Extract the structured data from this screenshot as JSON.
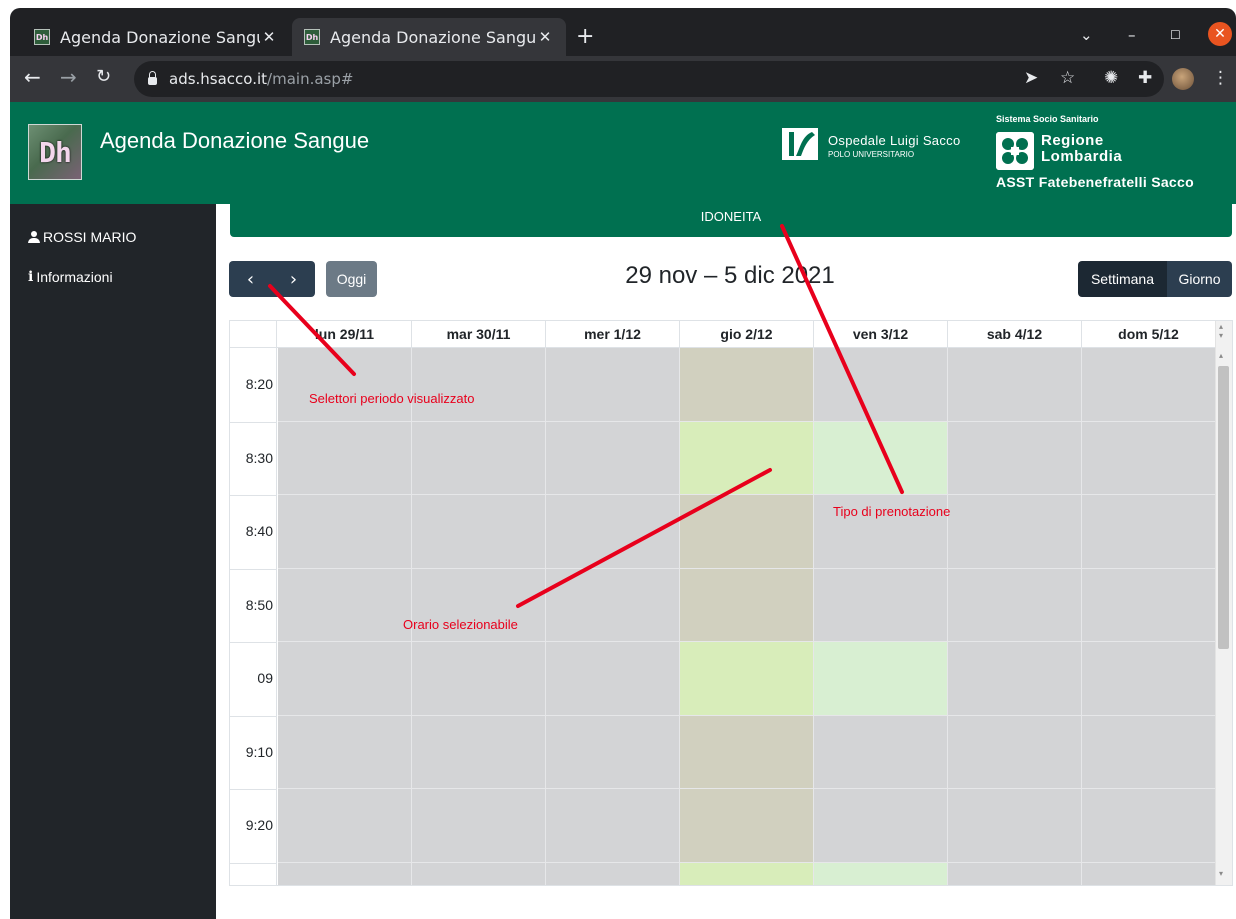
{
  "browser": {
    "tabs": [
      {
        "title": "Agenda Donazione Sangue",
        "favicon": "Dh",
        "active": false
      },
      {
        "title": "Agenda Donazione Sangue",
        "favicon": "Dh",
        "active": true
      }
    ],
    "new_tab_symbol": "+",
    "url_host": "ads.hsacco.it",
    "url_path": "/main.asp#"
  },
  "header": {
    "logo_text": "Dh",
    "title": "Agenda Donazione Sangue",
    "hospital_name": "Ospedale Luigi Sacco",
    "hospital_subtitle": "POLO UNIVERSITARIO",
    "region_top": "Sistema Socio Sanitario",
    "region_name_1": "Regione",
    "region_name_2": "Lombardia",
    "asst": "ASST Fatebenefratelli Sacco"
  },
  "sidebar": {
    "user": "ROSSI MARIO",
    "info": "Informazioni"
  },
  "booking_type": "IDONEITA",
  "toolbar": {
    "prev_symbol": "‹",
    "next_symbol": "›",
    "today_label": "Oggi",
    "range_title": "29 nov – 5 dic 2021",
    "view_week": "Settimana",
    "view_day": "Giorno"
  },
  "calendar": {
    "days": [
      "lun 29/11",
      "mar 30/11",
      "mer 1/12",
      "gio 2/12",
      "ven 3/12",
      "sab 4/12",
      "dom 5/12"
    ],
    "times": [
      "8:20",
      "8:30",
      "8:40",
      "8:50",
      "09",
      "9:10",
      "9:20",
      ""
    ],
    "colors": {
      "unavailable": "#d3d4d6",
      "closed": "#d1d0bf",
      "selectable_thu": "#d8edba",
      "selectable_fri": "#d8efd2"
    },
    "grid": [
      [
        "unavailable",
        "unavailable",
        "unavailable",
        "closed",
        "unavailable",
        "unavailable",
        "unavailable"
      ],
      [
        "unavailable",
        "unavailable",
        "unavailable",
        "selectable_thu",
        "selectable_fri",
        "unavailable",
        "unavailable"
      ],
      [
        "unavailable",
        "unavailable",
        "unavailable",
        "closed",
        "unavailable",
        "unavailable",
        "unavailable"
      ],
      [
        "unavailable",
        "unavailable",
        "unavailable",
        "closed",
        "unavailable",
        "unavailable",
        "unavailable"
      ],
      [
        "unavailable",
        "unavailable",
        "unavailable",
        "selectable_thu",
        "selectable_fri",
        "unavailable",
        "unavailable"
      ],
      [
        "unavailable",
        "unavailable",
        "unavailable",
        "closed",
        "unavailable",
        "unavailable",
        "unavailable"
      ],
      [
        "unavailable",
        "unavailable",
        "unavailable",
        "closed",
        "unavailable",
        "unavailable",
        "unavailable"
      ],
      [
        "unavailable",
        "unavailable",
        "unavailable",
        "selectable_thu",
        "selectable_fri",
        "unavailable",
        "unavailable"
      ]
    ]
  },
  "annotations": {
    "color": "#e8001c",
    "period_selectors": "Selettori periodo visualizzato",
    "booking_type": "Tipo di prenotazione",
    "selectable_time": "Orario selezionabile"
  }
}
